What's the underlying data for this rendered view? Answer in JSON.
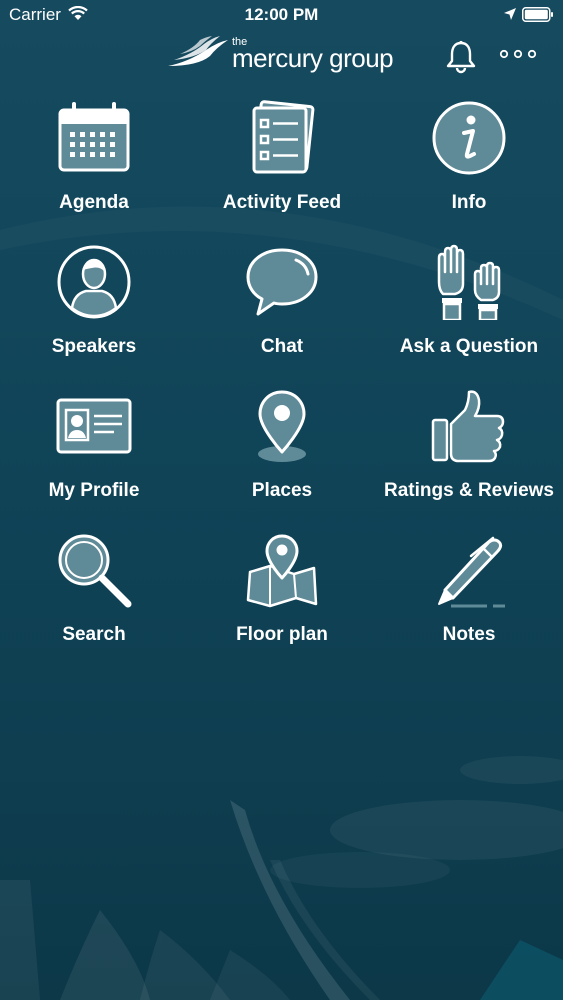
{
  "status_bar": {
    "carrier": "Carrier",
    "time": "12:00 PM"
  },
  "header": {
    "logo_small": "the",
    "logo_text": "mercury group"
  },
  "menu": [
    {
      "label": "Agenda",
      "icon": "calendar-icon"
    },
    {
      "label": "Activity Feed",
      "icon": "checklist-icon"
    },
    {
      "label": "Info",
      "icon": "info-icon"
    },
    {
      "label": "Speakers",
      "icon": "person-icon"
    },
    {
      "label": "Chat",
      "icon": "speech-bubble-icon"
    },
    {
      "label": "Ask a Question",
      "icon": "raised-hands-icon"
    },
    {
      "label": "My Profile",
      "icon": "id-card-icon"
    },
    {
      "label": "Places",
      "icon": "map-pin-icon"
    },
    {
      "label": "Ratings & Reviews",
      "icon": "thumbs-up-icon"
    },
    {
      "label": "Search",
      "icon": "magnifier-icon"
    },
    {
      "label": "Floor plan",
      "icon": "folded-map-icon"
    },
    {
      "label": "Notes",
      "icon": "pen-icon"
    }
  ],
  "colors": {
    "background": "#12465a",
    "icon_fill": "#5f8a97",
    "icon_stroke": "#ffffff"
  }
}
